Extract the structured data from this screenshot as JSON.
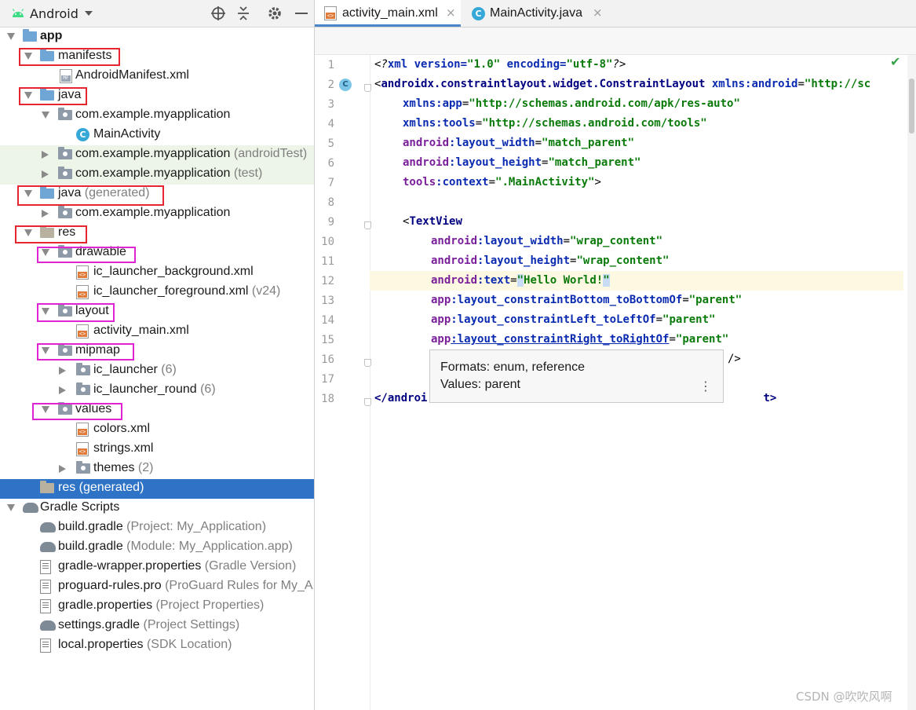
{
  "project_panel": {
    "view_name": "Android",
    "toolbar_icons": [
      "crosshair-icon",
      "collapse-icon",
      "gear-icon",
      "minimize-icon"
    ]
  },
  "tree": [
    {
      "label": "app",
      "sub": "",
      "icon": "module-folder"
    },
    {
      "label": "manifests",
      "sub": "",
      "icon": "folder"
    },
    {
      "label": "AndroidManifest.xml",
      "sub": "",
      "icon": "manifest-file"
    },
    {
      "label": "java",
      "sub": "",
      "icon": "folder"
    },
    {
      "label": "com.example.myapplication",
      "sub": "",
      "icon": "package"
    },
    {
      "label": "MainActivity",
      "sub": "",
      "icon": "class"
    },
    {
      "label": "com.example.myapplication",
      "sub": " (androidTest)",
      "icon": "package"
    },
    {
      "label": "com.example.myapplication",
      "sub": " (test)",
      "icon": "package"
    },
    {
      "label": "java",
      "sub": " (generated)",
      "icon": "generated-folder"
    },
    {
      "label": "com.example.myapplication",
      "sub": "",
      "icon": "package"
    },
    {
      "label": "res",
      "sub": "",
      "icon": "res-folder"
    },
    {
      "label": "drawable",
      "sub": "",
      "icon": "package"
    },
    {
      "label": "ic_launcher_background.xml",
      "sub": "",
      "icon": "xml-file"
    },
    {
      "label": "ic_launcher_foreground.xml",
      "sub": " (v24)",
      "icon": "xml-file"
    },
    {
      "label": "layout",
      "sub": "",
      "icon": "package"
    },
    {
      "label": "activity_main.xml",
      "sub": "",
      "icon": "xml-file"
    },
    {
      "label": "mipmap",
      "sub": "",
      "icon": "package"
    },
    {
      "label": "ic_launcher",
      "sub": " (6)",
      "icon": "package"
    },
    {
      "label": "ic_launcher_round",
      "sub": " (6)",
      "icon": "package"
    },
    {
      "label": "values",
      "sub": "",
      "icon": "package"
    },
    {
      "label": "colors.xml",
      "sub": "",
      "icon": "xml-file"
    },
    {
      "label": "strings.xml",
      "sub": "",
      "icon": "xml-file"
    },
    {
      "label": "themes",
      "sub": " (2)",
      "icon": "package"
    },
    {
      "label": "res (generated)",
      "sub": "",
      "icon": "res-folder"
    },
    {
      "label": "Gradle Scripts",
      "sub": "",
      "icon": "gradle"
    },
    {
      "label": "build.gradle",
      "sub": " (Project: My_Application)",
      "icon": "gradle"
    },
    {
      "label": "build.gradle",
      "sub": " (Module: My_Application.app)",
      "icon": "gradle"
    },
    {
      "label": "gradle-wrapper.properties",
      "sub": " (Gradle Version)",
      "icon": "properties"
    },
    {
      "label": "proguard-rules.pro",
      "sub": " (ProGuard Rules for My_A",
      "icon": "properties"
    },
    {
      "label": "gradle.properties",
      "sub": " (Project Properties)",
      "icon": "properties"
    },
    {
      "label": "settings.gradle",
      "sub": " (Project Settings)",
      "icon": "gradle"
    },
    {
      "label": "local.properties",
      "sub": " (SDK Location)",
      "icon": "properties"
    }
  ],
  "tabs": [
    {
      "label": "activity_main.xml",
      "close": "×"
    },
    {
      "label": "MainActivity.java",
      "close": "×"
    }
  ],
  "gutter_marker": "C",
  "class_marker": "C",
  "line_numbers": [
    "1",
    "2",
    "3",
    "4",
    "5",
    "6",
    "7",
    "8",
    "9",
    "10",
    "11",
    "12",
    "13",
    "14",
    "15",
    "16",
    "17",
    "18"
  ],
  "code": {
    "l1": [
      "<?",
      "xml version=",
      "\"1.0\"",
      " encoding=",
      "\"utf-8\"",
      "?>"
    ],
    "l2_tag": "androidx.constraintlayout.widget.ConstraintLayout",
    "l2_attr": " xmlns:android",
    "l2_val": "\"http://sc",
    "l3_attr": "xmlns:app",
    "l3_val": "\"http://schemas.android.com/apk/res-auto\"",
    "l4_attr": "xmlns:tools",
    "l4_val": "\"http://schemas.android.com/tools\"",
    "l5_ns": "android",
    "l5_attr": ":layout_width",
    "l5_val": "\"match_parent\"",
    "l6_ns": "android",
    "l6_attr": ":layout_height",
    "l6_val": "\"match_parent\"",
    "l7_ns": "tools",
    "l7_attr": ":context",
    "l7_val": "\".MainActivity\"",
    "l7_end": ">",
    "l9_tag": "TextView",
    "l10_ns": "android",
    "l10_attr": ":layout_width",
    "l10_val": "\"wrap_content\"",
    "l11_ns": "android",
    "l11_attr": ":layout_height",
    "l11_val": "\"wrap_content\"",
    "l12_ns": "android",
    "l12_attr": ":text",
    "l12_val_q1": "\"",
    "l12_val": "Hello World!",
    "l12_val_q2": "\"",
    "l13_ns": "app",
    "l13_attr": ":layout_constraintBottom_toBottomOf",
    "l13_val": "\"parent\"",
    "l14_ns": "app",
    "l14_attr": ":layout_constraintLeft_toLeftOf",
    "l14_val": "\"parent\"",
    "l15_ns": "app",
    "l15_attr": ":layout_constraintRight_toRightOf",
    "l15_val": "\"parent\"",
    "l16_end": "/>",
    "l18_a": "</androi",
    "l18_b": "t>"
  },
  "tooltip": {
    "line1": "Formats: enum, reference",
    "line2": "Values: parent",
    "more": "⋮"
  },
  "status_check": "✔",
  "watermark": "CSDN @吹吹风啊",
  "colors": {
    "selected": "#2f73c6",
    "annotation_red": "#e6262f",
    "annotation_magenta": "#e024d4",
    "test_highlight": "#edf5e8"
  }
}
